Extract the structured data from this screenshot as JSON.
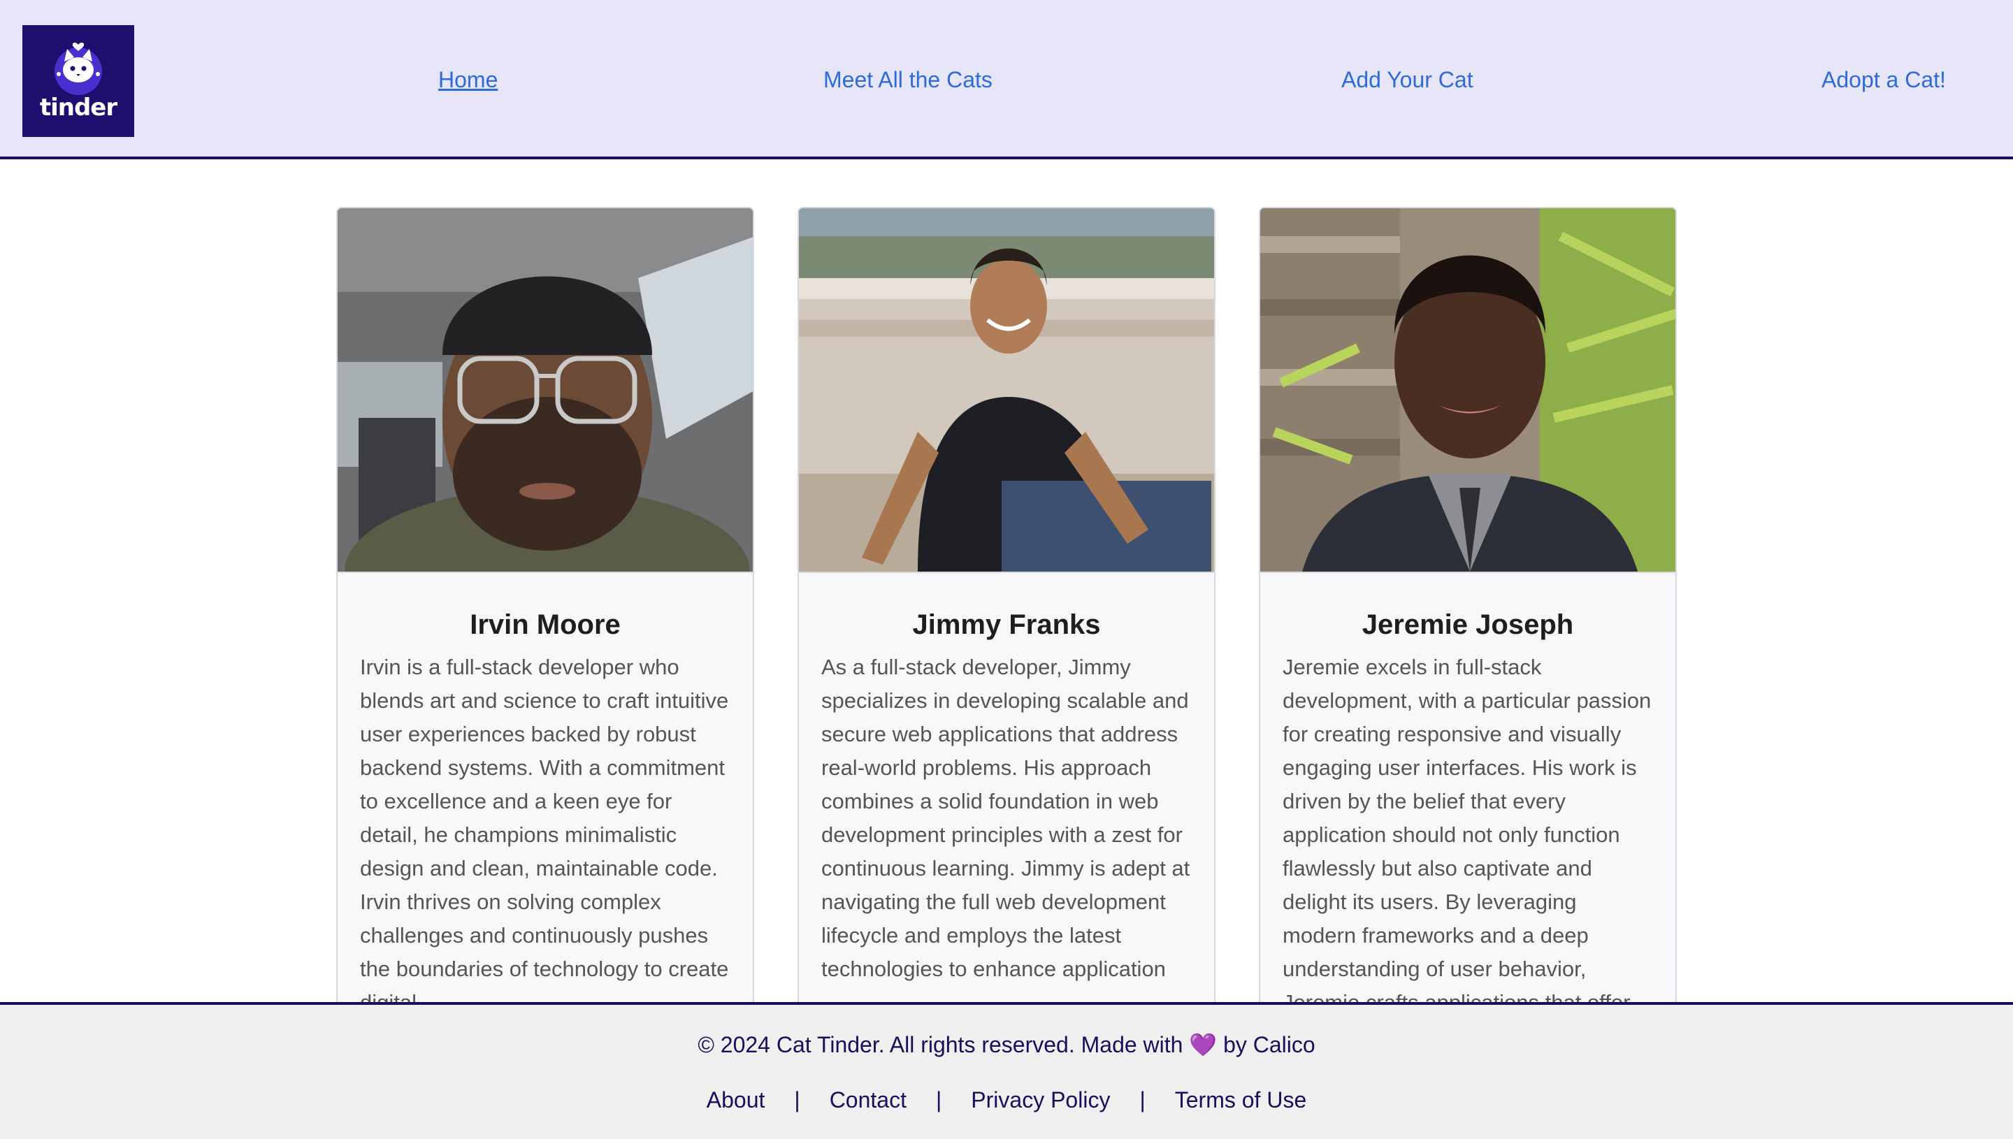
{
  "brand": {
    "logo_text": "tinder",
    "logo_icon": "cat-heart-icon"
  },
  "nav": [
    {
      "label": "Home",
      "active": true
    },
    {
      "label": "Meet All the Cats",
      "active": false
    },
    {
      "label": "Add Your Cat",
      "active": false
    },
    {
      "label": "Adopt a Cat!",
      "active": false
    }
  ],
  "cards": [
    {
      "name": "Irvin Moore",
      "bio": "Irvin is a full-stack developer who blends art and science to craft intuitive user experiences backed by robust backend systems. With a commitment to excellence and a keen eye for detail, he champions minimalistic design and clean, maintainable code. Irvin thrives on solving complex challenges and continuously pushes the boundaries of technology to create digital"
    },
    {
      "name": "Jimmy Franks",
      "bio": "As a full-stack developer, Jimmy specializes in developing scalable and secure web applications that address real-world problems. His approach combines a solid foundation in web development principles with a zest for continuous learning. Jimmy is adept at navigating the full web development lifecycle and employs the latest technologies to enhance application"
    },
    {
      "name": "Jeremie Joseph",
      "bio": "Jeremie excels in full-stack development, with a particular passion for creating responsive and visually engaging user interfaces. His work is driven by the belief that every application should not only function flawlessly but also captivate and delight its users. By leveraging modern frameworks and a deep understanding of user behavior, Jeremie crafts applications that offer"
    }
  ],
  "footer": {
    "copyright_before": "© 2024 Cat Tinder. All rights reserved. Made with",
    "heart": "💜",
    "copyright_after": "by Calico",
    "links": [
      "About",
      "Contact",
      "Privacy Policy",
      "Terms of Use"
    ],
    "separator": "|"
  },
  "colors": {
    "header_bg": "#e6e6f8",
    "accent": "#1a0d5c",
    "link": "#2f6bd8",
    "footer_bg": "#efefef"
  }
}
